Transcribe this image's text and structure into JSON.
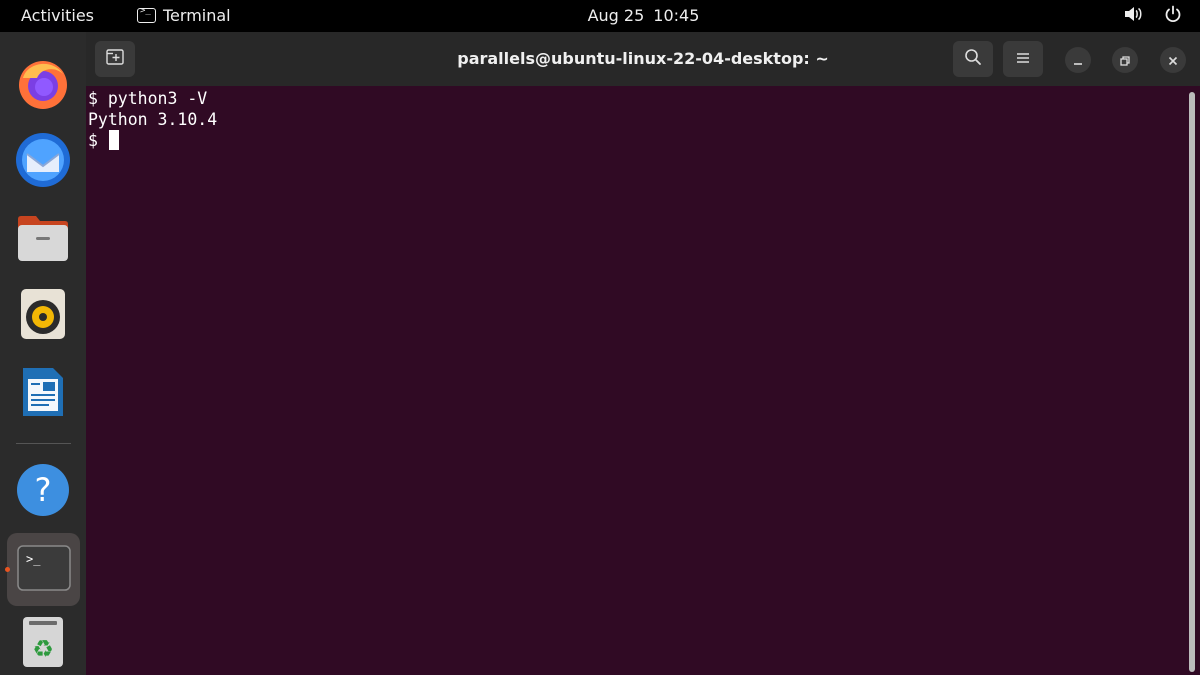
{
  "topbar": {
    "activities": "Activities",
    "app_name": "Terminal",
    "date": "Aug 25",
    "time": "10:45",
    "icons": [
      "volume-icon",
      "power-icon"
    ]
  },
  "dock": {
    "items": [
      {
        "name": "firefox",
        "icon": "firefox-icon"
      },
      {
        "name": "thunderbird",
        "icon": "thunderbird-icon"
      },
      {
        "name": "files",
        "icon": "files-icon"
      },
      {
        "name": "rhythmbox",
        "icon": "rhythmbox-icon"
      },
      {
        "name": "libreoffice-writer",
        "icon": "writer-icon"
      },
      {
        "name": "help",
        "icon": "help-icon"
      },
      {
        "name": "terminal",
        "icon": "terminal-icon",
        "active": true
      },
      {
        "name": "trash",
        "icon": "trash-icon"
      }
    ]
  },
  "window": {
    "title": "parallels@ubuntu-linux-22-04-desktop: ~",
    "buttons": [
      "new-tab",
      "search",
      "menu",
      "minimize",
      "maximize",
      "close"
    ]
  },
  "terminal": {
    "lines": [
      "$ python3 -V",
      "Python 3.10.4",
      "$ "
    ],
    "colors": {
      "background": "#300a24",
      "foreground": "#ffffff"
    }
  }
}
